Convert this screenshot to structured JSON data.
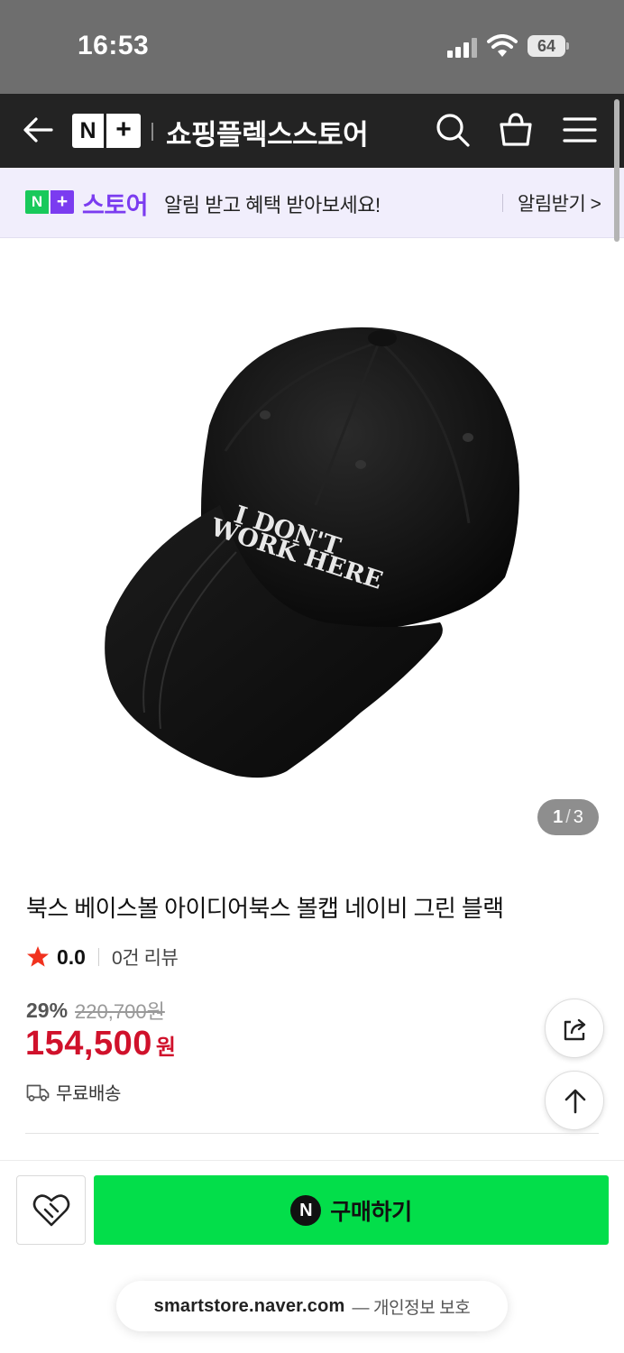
{
  "status_bar": {
    "time": "16:53",
    "battery": "64"
  },
  "header": {
    "logo": {
      "n": "N",
      "plus": "+"
    },
    "title": "쇼핑플렉스스토어",
    "icons": [
      "back-icon",
      "search-icon",
      "cart-icon",
      "menu-icon"
    ]
  },
  "notice": {
    "logo": {
      "n": "N",
      "plus": "+"
    },
    "brand": "스토어",
    "text": "알림 받고 혜택 받아보세요!",
    "action": "알림받기 >"
  },
  "product": {
    "image_alt": "black baseball cap",
    "hat_text": [
      "I DON'T",
      "WORK HERE"
    ],
    "image_counter": {
      "current": "1",
      "total": "3"
    },
    "title": "북스 베이스볼 아이디어북스 볼캡 네이비 그린 블랙",
    "rating": "0.0",
    "review_count": "0건 리뷰",
    "discount_rate": "29%",
    "original_price": "220,700원",
    "sale_price": "154,500",
    "currency": "원",
    "shipping": "무료배송"
  },
  "colors": {
    "accent_red": "#d0112b",
    "buy_green": "#03de4a",
    "brand_purple": "#7b3cf0",
    "naver_green": "#19c95b"
  },
  "bottom_bar": {
    "buy_icon": "N",
    "buy_label": "구매하기",
    "url_domain": "smartstore.naver.com",
    "url_note": "— 개인정보 보호"
  }
}
